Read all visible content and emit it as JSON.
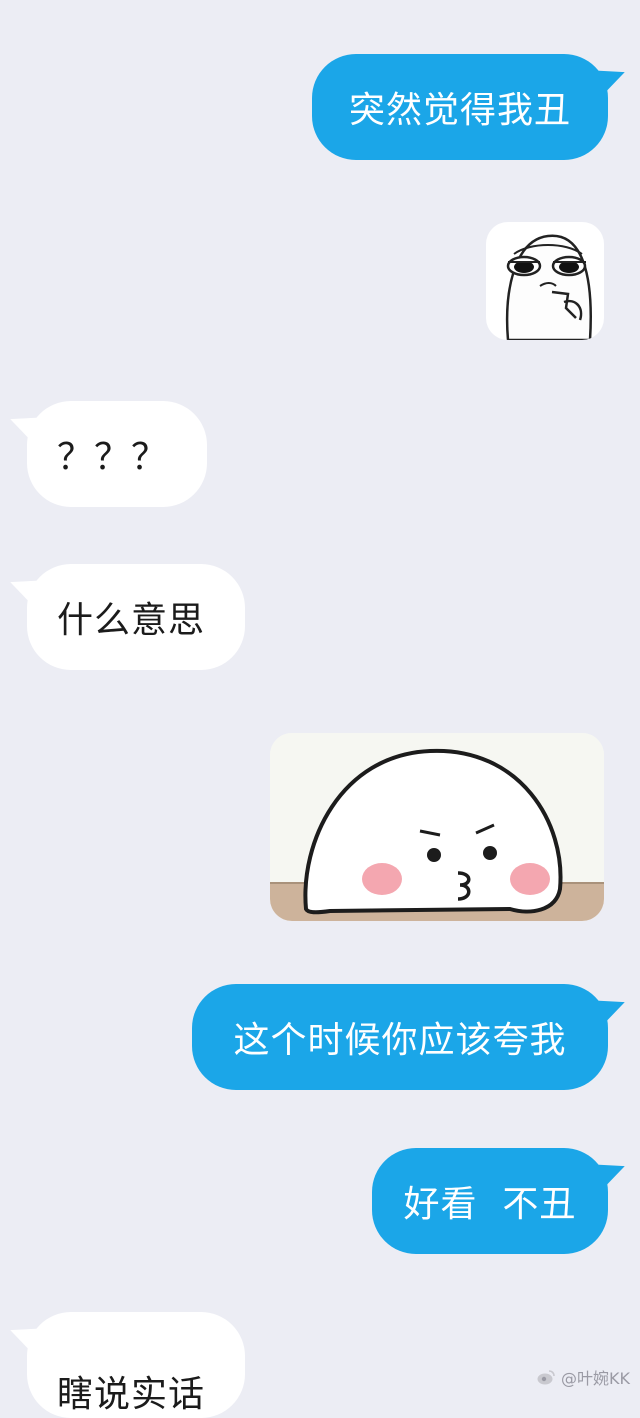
{
  "messages": [
    {
      "side": "out",
      "text": "突然觉得我丑"
    },
    {
      "side": "out",
      "sticker": "meme-face-sticker"
    },
    {
      "side": "in",
      "text": "？？？"
    },
    {
      "side": "in",
      "text": "什么意思"
    },
    {
      "side": "out",
      "sticker": "bun-pout-sticker"
    },
    {
      "side": "out",
      "text": "这个时候你应该夸我"
    },
    {
      "side": "out",
      "text": "好看  不丑"
    },
    {
      "side": "in",
      "text": "瞎说实话"
    }
  ],
  "watermark": {
    "text": "@叶婉KK",
    "icon": "weibo-icon"
  },
  "colors": {
    "background": "#ecedf4",
    "outgoing": "#1ba6e8",
    "incoming": "#ffffff"
  }
}
